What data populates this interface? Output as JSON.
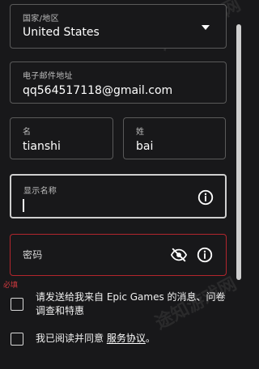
{
  "country": {
    "label": "国家/地区",
    "value": "United States"
  },
  "email": {
    "label": "电子邮件地址",
    "value": "qq564517118@gmail.com"
  },
  "first_name": {
    "label": "名",
    "value": "tianshi"
  },
  "last_name": {
    "label": "姓",
    "value": "bai"
  },
  "display_name": {
    "label": "显示名称",
    "value": ""
  },
  "password": {
    "label": "密码",
    "error": "必填"
  },
  "consents": [
    {
      "text": "请发送给我来自 Epic Games 的消息、问卷调查和特惠"
    },
    {
      "text_prefix": "我已阅读并同意 ",
      "link": "服务协议",
      "text_suffix": "。"
    }
  ],
  "watermark": {
    "text": "途知游戏网"
  },
  "colors": {
    "background": "#18181a",
    "border": "#5a5a5a",
    "error": "#d23a3f",
    "text": "#ffffff"
  },
  "icons": {
    "country_dropdown": "chevron-down-icon",
    "display_name_info": "info-icon",
    "password_visibility": "eye-off-icon",
    "password_info": "info-icon"
  }
}
